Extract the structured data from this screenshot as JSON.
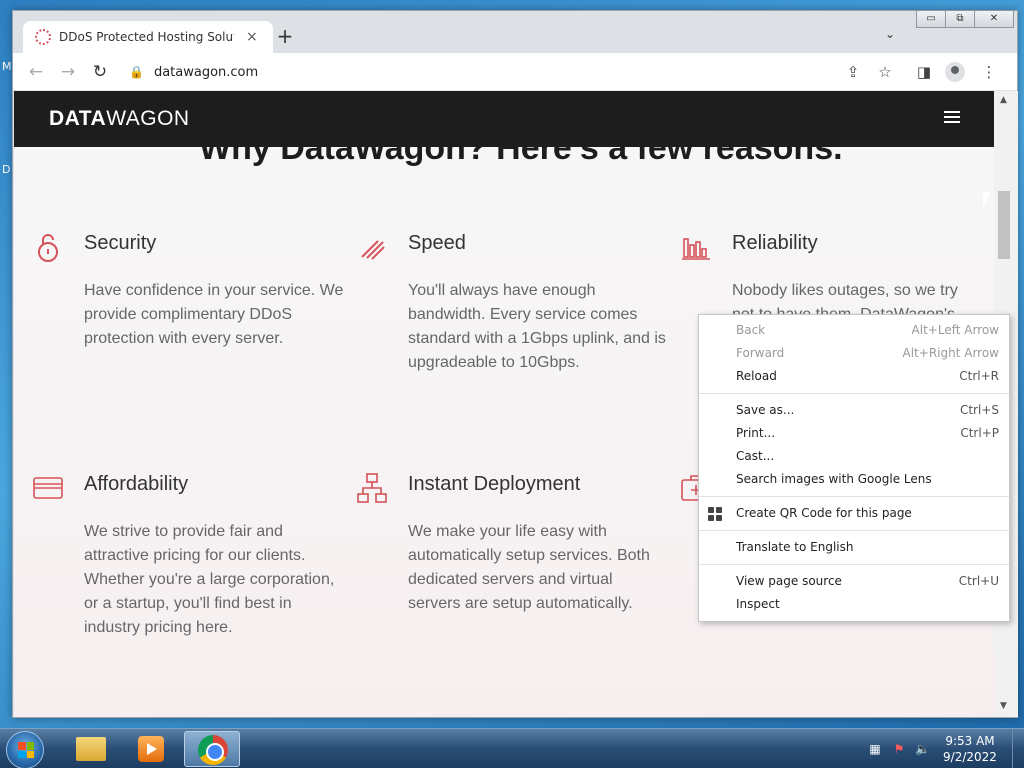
{
  "desktop": {
    "labels": [
      "M",
      "D"
    ]
  },
  "browser": {
    "tab_title": "DDoS Protected Hosting Solution",
    "tab_close": "×",
    "new_tab": "+",
    "tab_search": "⌄",
    "window_controls": {
      "minimize": "▭",
      "maximize": "⧉",
      "close": "✕"
    },
    "nav": {
      "back": "←",
      "forward": "→",
      "reload": "↻"
    },
    "url": "datawagon.com",
    "lock": "🔒"
  },
  "site": {
    "logo_bold": "DATA",
    "logo_light": "WAGON",
    "heading": "Why DataWagon? Here's a few reasons.",
    "features": [
      {
        "title": "Security",
        "body": "Have confidence in your service. We provide complimentary DDoS protection with every server."
      },
      {
        "title": "Speed",
        "body": "You'll always have enough bandwidth. Every service comes standard with a 1Gbps uplink, and is upgradeable to 10Gbps."
      },
      {
        "title": "Reliability",
        "body": "Nobody likes outages, so we try not to have them. DataWagon's"
      },
      {
        "title": "Affordability",
        "body": "We strive to provide fair and attractive pricing for our clients. Whether you're a large corporation, or a startup, you'll find best in industry pricing here."
      },
      {
        "title": "Instant Deployment",
        "body": "We make your life easy with automatically setup services. Both dedicated servers and virtual servers are setup automatically."
      }
    ],
    "accent_color": "#d6535a"
  },
  "context_menu": {
    "groups": [
      [
        {
          "label": "Back",
          "shortcut": "Alt+Left Arrow",
          "disabled": true
        },
        {
          "label": "Forward",
          "shortcut": "Alt+Right Arrow",
          "disabled": true
        },
        {
          "label": "Reload",
          "shortcut": "Ctrl+R",
          "disabled": false
        }
      ],
      [
        {
          "label": "Save as...",
          "shortcut": "Ctrl+S",
          "disabled": false
        },
        {
          "label": "Print...",
          "shortcut": "Ctrl+P",
          "disabled": false
        },
        {
          "label": "Cast...",
          "shortcut": "",
          "disabled": false
        },
        {
          "label": "Search images with Google Lens",
          "shortcut": "",
          "disabled": false
        }
      ],
      [
        {
          "label": "Create QR Code for this page",
          "shortcut": "",
          "disabled": false,
          "icon": "qr-code-icon"
        }
      ],
      [
        {
          "label": "Translate to English",
          "shortcut": "",
          "disabled": false
        }
      ],
      [
        {
          "label": "View page source",
          "shortcut": "Ctrl+U",
          "disabled": false
        },
        {
          "label": "Inspect",
          "shortcut": "",
          "disabled": false
        }
      ]
    ]
  },
  "taskbar": {
    "time": "9:53 AM",
    "date": "9/2/2022"
  }
}
